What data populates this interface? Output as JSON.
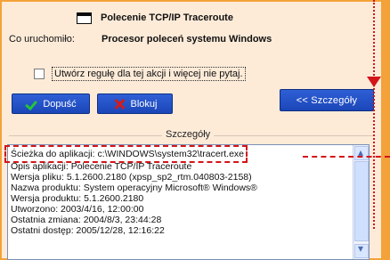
{
  "header": {
    "app_title": "Polecenie TCP/IP Traceroute",
    "run_label": "Co uruchomiło:",
    "run_value": "Procesor poleceń systemu Windows"
  },
  "options": {
    "remember_label": "Utwórz regułę dla tej akcji i więcej nie pytaj."
  },
  "actions": {
    "allow_label": "Dopuść",
    "block_label": "Blokuj",
    "details_label": "<< Szczegóły"
  },
  "details": {
    "section_title": "Szczegóły",
    "lines": [
      "Ścieżka do aplikacji: c:\\WINDOWS\\system32\\tracert.exe",
      "Opis aplikacji: Polecenie TCP/IP Traceroute",
      "Wersja pliku: 5.1.2600.2180 (xpsp_sp2_rtm.040803-2158)",
      "Nazwa produktu: System operacyjny Microsoft® Windows®",
      "Wersja produktu: 5.1.2600.2180",
      "Utworzono: 2003/4/16, 12:00:00",
      "Ostatnia zmiana: 2004/8/3, 23:44:28",
      "Ostatni dostęp: 2005/12/28, 12:16:22"
    ]
  },
  "colors": {
    "background_orange": "#f3a23a",
    "dialog_bg": "#fdebd8",
    "button_blue": "#1b46b8",
    "annotation_red": "#d3151a"
  },
  "icons": {
    "app": "application-window-icon",
    "allow": "check-icon",
    "block": "x-icon"
  }
}
